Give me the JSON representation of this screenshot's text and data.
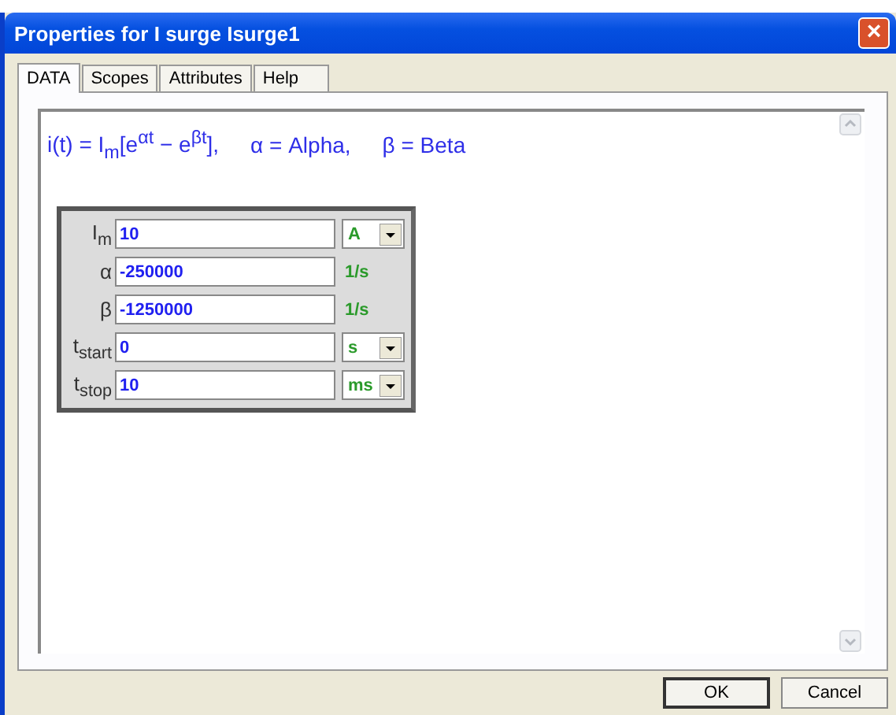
{
  "window": {
    "title": "Properties for I surge Isurge1",
    "close": "×"
  },
  "tabs": [
    {
      "label": "DATA",
      "selected": true
    },
    {
      "label": "Scopes",
      "selected": false
    },
    {
      "label": "Attributes",
      "selected": false
    },
    {
      "label": "Help",
      "selected": false
    }
  ],
  "formula": "i(t) = I$_{m}$[e$^{αt}$ − e$^{βt}$],",
  "definitions": [
    "α = Alpha,",
    "β = Beta"
  ],
  "parameters": [
    {
      "label": "I$_{m}$",
      "value": "10",
      "unit": {
        "kind": "dropdown",
        "text": "A"
      }
    },
    {
      "label": "α",
      "value": "-250000",
      "unit": {
        "kind": "text",
        "text": "1/s"
      }
    },
    {
      "label": "β",
      "value": "-1250000",
      "unit": {
        "kind": "text",
        "text": "1/s"
      }
    },
    {
      "label": "t$_{start}$",
      "value": "0",
      "unit": {
        "kind": "dropdown",
        "text": "s"
      }
    },
    {
      "label": "t$_{stop}$",
      "value": "10",
      "unit": {
        "kind": "dropdown",
        "text": "ms"
      }
    }
  ],
  "buttons": [
    {
      "label": "OK",
      "default": true
    },
    {
      "label": "Cancel",
      "default": false
    }
  ]
}
